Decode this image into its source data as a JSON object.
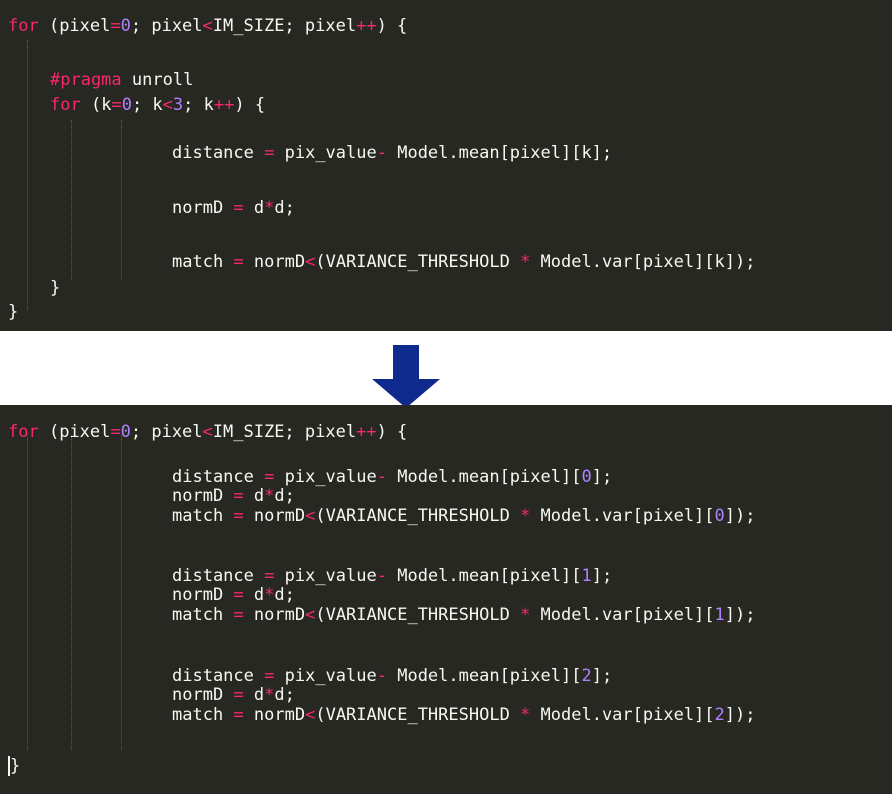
{
  "colors": {
    "background": "#272822",
    "text": "#f8f8f2",
    "keyword": "#f92672",
    "number": "#ae81ff",
    "arrow": "#0d2a8c"
  },
  "arrow_icon": "down-arrow",
  "before": {
    "lines": [
      {
        "indent": 0,
        "tokens": [
          {
            "t": "for",
            "c": "kw"
          },
          {
            "t": " (pixel"
          },
          {
            "t": "=",
            "c": "op"
          },
          {
            "t": "0",
            "c": "num"
          },
          {
            "t": "; pixel"
          },
          {
            "t": "<",
            "c": "op"
          },
          {
            "t": "IM_SIZE; pixel"
          },
          {
            "t": "++",
            "c": "op"
          },
          {
            "t": ") {"
          }
        ]
      },
      {
        "indent": 0,
        "tokens": []
      },
      {
        "indent": 1,
        "tokens": [
          {
            "t": "#pragma",
            "c": "pre"
          },
          {
            "t": " unroll"
          }
        ]
      },
      {
        "indent": 1,
        "tokens": [
          {
            "t": "for",
            "c": "kw"
          },
          {
            "t": " (k"
          },
          {
            "t": "=",
            "c": "op"
          },
          {
            "t": "0",
            "c": "num"
          },
          {
            "t": "; k"
          },
          {
            "t": "<",
            "c": "op"
          },
          {
            "t": "3",
            "c": "num"
          },
          {
            "t": "; k"
          },
          {
            "t": "++",
            "c": "op"
          },
          {
            "t": ") {"
          }
        ]
      },
      {
        "indent": 0,
        "tokens": []
      },
      {
        "indent": 3,
        "tokens": [
          {
            "t": "distance "
          },
          {
            "t": "=",
            "c": "op"
          },
          {
            "t": " pix_value"
          },
          {
            "t": "-",
            "c": "op"
          },
          {
            "t": " Model.mean[pixel][k];"
          }
        ]
      },
      {
        "indent": 0,
        "tokens": []
      },
      {
        "indent": 3,
        "tokens": [
          {
            "t": "normD "
          },
          {
            "t": "=",
            "c": "op"
          },
          {
            "t": " d"
          },
          {
            "t": "*",
            "c": "op"
          },
          {
            "t": "d;"
          }
        ]
      },
      {
        "indent": 0,
        "tokens": []
      },
      {
        "indent": 3,
        "tokens": [
          {
            "t": "match "
          },
          {
            "t": "=",
            "c": "op"
          },
          {
            "t": " normD"
          },
          {
            "t": "<",
            "c": "op"
          },
          {
            "t": "(VARIANCE_THRESHOLD "
          },
          {
            "t": "*",
            "c": "op"
          },
          {
            "t": " Model.var[pixel][k]);"
          }
        ]
      },
      {
        "indent": 1,
        "tokens": [
          {
            "t": "}"
          }
        ]
      },
      {
        "indent": 0,
        "tokens": [
          {
            "t": "}"
          }
        ]
      }
    ]
  },
  "after": {
    "lines": [
      {
        "indent": 0,
        "tokens": [
          {
            "t": "for",
            "c": "kw"
          },
          {
            "t": " (pixel"
          },
          {
            "t": "=",
            "c": "op"
          },
          {
            "t": "0",
            "c": "num"
          },
          {
            "t": "; pixel"
          },
          {
            "t": "<",
            "c": "op"
          },
          {
            "t": "IM_SIZE; pixel"
          },
          {
            "t": "++",
            "c": "op"
          },
          {
            "t": ") {"
          }
        ]
      },
      {
        "indent": 0,
        "tokens": []
      },
      {
        "indent": 3,
        "tokens": [
          {
            "t": "distance "
          },
          {
            "t": "=",
            "c": "op"
          },
          {
            "t": " pix_value"
          },
          {
            "t": "-",
            "c": "op"
          },
          {
            "t": " Model.mean[pixel]["
          },
          {
            "t": "0",
            "c": "num"
          },
          {
            "t": "];"
          }
        ]
      },
      {
        "indent": 3,
        "tokens": [
          {
            "t": "normD "
          },
          {
            "t": "=",
            "c": "op"
          },
          {
            "t": " d"
          },
          {
            "t": "*",
            "c": "op"
          },
          {
            "t": "d;"
          }
        ]
      },
      {
        "indent": 3,
        "tokens": [
          {
            "t": "match "
          },
          {
            "t": "=",
            "c": "op"
          },
          {
            "t": " normD"
          },
          {
            "t": "<",
            "c": "op"
          },
          {
            "t": "(VARIANCE_THRESHOLD "
          },
          {
            "t": "*",
            "c": "op"
          },
          {
            "t": " Model.var[pixel]["
          },
          {
            "t": "0",
            "c": "num"
          },
          {
            "t": "]);"
          }
        ]
      },
      {
        "indent": 0,
        "tokens": []
      },
      {
        "indent": 3,
        "tokens": [
          {
            "t": "distance "
          },
          {
            "t": "=",
            "c": "op"
          },
          {
            "t": " pix_value"
          },
          {
            "t": "-",
            "c": "op"
          },
          {
            "t": " Model.mean[pixel]["
          },
          {
            "t": "1",
            "c": "num"
          },
          {
            "t": "];"
          }
        ]
      },
      {
        "indent": 3,
        "tokens": [
          {
            "t": "normD "
          },
          {
            "t": "=",
            "c": "op"
          },
          {
            "t": " d"
          },
          {
            "t": "*",
            "c": "op"
          },
          {
            "t": "d;"
          }
        ]
      },
      {
        "indent": 3,
        "tokens": [
          {
            "t": "match "
          },
          {
            "t": "=",
            "c": "op"
          },
          {
            "t": " normD"
          },
          {
            "t": "<",
            "c": "op"
          },
          {
            "t": "(VARIANCE_THRESHOLD "
          },
          {
            "t": "*",
            "c": "op"
          },
          {
            "t": " Model.var[pixel]["
          },
          {
            "t": "1",
            "c": "num"
          },
          {
            "t": "]);"
          }
        ]
      },
      {
        "indent": 0,
        "tokens": []
      },
      {
        "indent": 3,
        "tokens": [
          {
            "t": "distance "
          },
          {
            "t": "=",
            "c": "op"
          },
          {
            "t": " pix_value"
          },
          {
            "t": "-",
            "c": "op"
          },
          {
            "t": " Model.mean[pixel]["
          },
          {
            "t": "2",
            "c": "num"
          },
          {
            "t": "];"
          }
        ]
      },
      {
        "indent": 3,
        "tokens": [
          {
            "t": "normD "
          },
          {
            "t": "=",
            "c": "op"
          },
          {
            "t": " d"
          },
          {
            "t": "*",
            "c": "op"
          },
          {
            "t": "d;"
          }
        ]
      },
      {
        "indent": 3,
        "tokens": [
          {
            "t": "match "
          },
          {
            "t": "=",
            "c": "op"
          },
          {
            "t": " normD"
          },
          {
            "t": "<",
            "c": "op"
          },
          {
            "t": "(VARIANCE_THRESHOLD "
          },
          {
            "t": "*",
            "c": "op"
          },
          {
            "t": " Model.var[pixel]["
          },
          {
            "t": "2",
            "c": "num"
          },
          {
            "t": "]);"
          }
        ]
      },
      {
        "indent": 0,
        "tokens": []
      },
      {
        "indent": 0,
        "tokens": [
          {
            "t": "}",
            "c": "cursor"
          }
        ]
      }
    ]
  }
}
